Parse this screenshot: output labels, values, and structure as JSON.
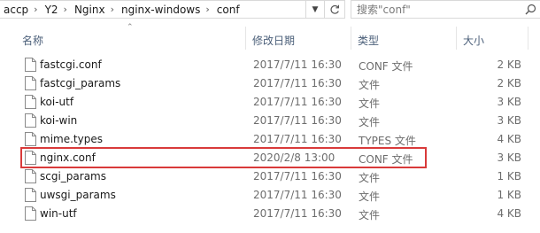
{
  "address_bar": {
    "breadcrumbs": [
      "accp",
      "Y2",
      "Nginx",
      "nginx-windows",
      "conf"
    ],
    "dropdown_icon": "chevron-down-icon",
    "refresh_icon": "refresh-icon"
  },
  "search": {
    "placeholder": "搜索\"conf\"",
    "icon": "search-icon"
  },
  "columns": {
    "name": "名称",
    "date": "修改日期",
    "type": "类型",
    "size": "大小"
  },
  "files": [
    {
      "name": "fastcgi.conf",
      "date": "2017/7/11 16:30",
      "type": "CONF 文件",
      "size": "2 KB"
    },
    {
      "name": "fastcgi_params",
      "date": "2017/7/11 16:30",
      "type": "文件",
      "size": "2 KB"
    },
    {
      "name": "koi-utf",
      "date": "2017/7/11 16:30",
      "type": "文件",
      "size": "3 KB"
    },
    {
      "name": "koi-win",
      "date": "2017/7/11 16:30",
      "type": "文件",
      "size": "3 KB"
    },
    {
      "name": "mime.types",
      "date": "2017/7/11 16:30",
      "type": "TYPES 文件",
      "size": "4 KB"
    },
    {
      "name": "nginx.conf",
      "date": "2020/2/8 13:00",
      "type": "CONF 文件",
      "size": "3 KB"
    },
    {
      "name": "scgi_params",
      "date": "2017/7/11 16:30",
      "type": "文件",
      "size": "1 KB"
    },
    {
      "name": "uwsgi_params",
      "date": "2017/7/11 16:30",
      "type": "文件",
      "size": "1 KB"
    },
    {
      "name": "win-utf",
      "date": "2017/7/11 16:30",
      "type": "文件",
      "size": "4 KB"
    }
  ],
  "highlighted_file": "nginx.conf",
  "colors": {
    "highlight_border": "#d93a3a",
    "column_header_text": "#4c607a",
    "secondary_text": "#6d6d6d"
  }
}
